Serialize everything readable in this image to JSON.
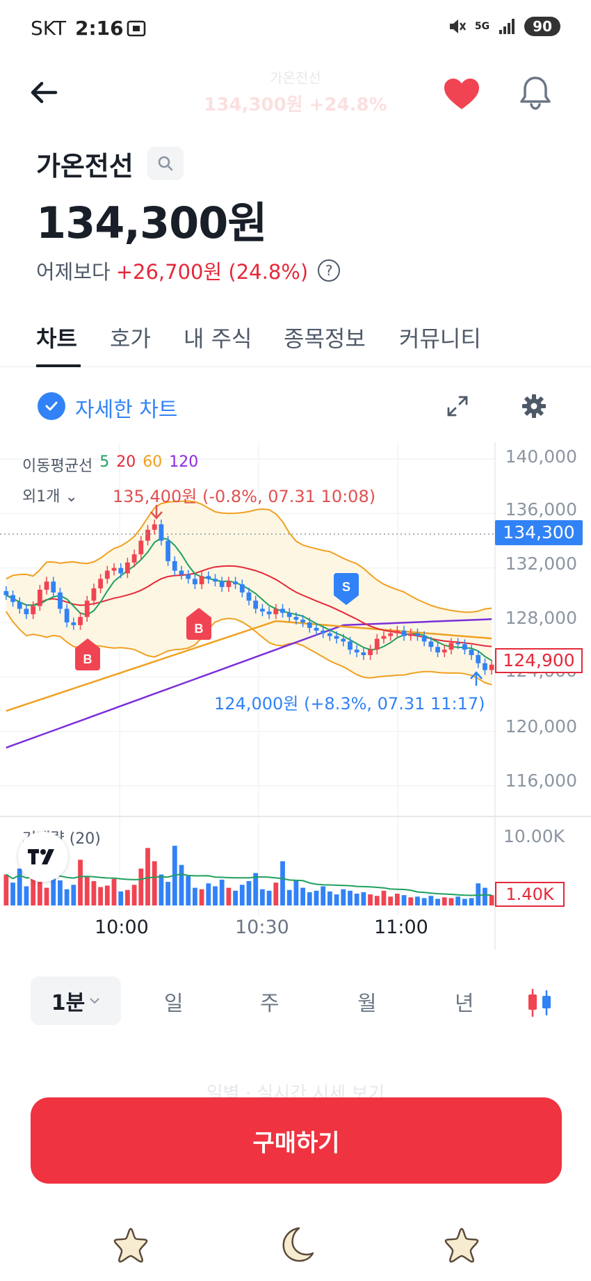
{
  "status_bar": {
    "carrier": "SKT",
    "time": "2:16",
    "network": "5G",
    "battery": "90"
  },
  "header": {
    "ghost_title": "가온전선",
    "ghost_price": "134,300원 +24.8%"
  },
  "stock": {
    "name": "가온전선",
    "price": "134,300원",
    "change_label": "어제보다",
    "change_value": "+26,700원 (24.8%)"
  },
  "tabs": [
    "차트",
    "호가",
    "내 주식",
    "종목정보",
    "커뮤니티"
  ],
  "chart_header": {
    "detail_label": "자세한 차트"
  },
  "chart_data": {
    "type": "candlestick",
    "interval": "1분",
    "legend_prefix": "이동평균선",
    "moving_averages": [
      {
        "period": "5",
        "color": "#1fa05e"
      },
      {
        "period": "20",
        "color": "#e42939"
      },
      {
        "period": "60",
        "color": "#f0a020"
      },
      {
        "period": "120",
        "color": "#8a2be2"
      }
    ],
    "sub_label": "외1개",
    "high_annotation": "135,400원 (-0.8%, 07.31 10:08)",
    "low_annotation": "124,000원 (+8.3%, 07.31 11:17)",
    "y_ticks": [
      "140,000",
      "136,000",
      "132,000",
      "128,000",
      "124,000",
      "120,000",
      "116,000"
    ],
    "ylim": [
      116000,
      140000
    ],
    "current_price_tag": "134,300",
    "last_price_tag": "124,900",
    "x_ticks": [
      "10:00",
      "10:30",
      "11:00"
    ],
    "markers": [
      {
        "label": "B",
        "color": "#f04452"
      },
      {
        "label": "B",
        "color": "#f04452"
      },
      {
        "label": "S",
        "color": "#3182f6"
      }
    ],
    "volume_label": "거래량 (20)",
    "volume_max": "10.00K",
    "volume_last": "1.40K",
    "closes": [
      130000,
      129500,
      129000,
      128600,
      129200,
      130400,
      131000,
      130200,
      129000,
      128000,
      127800,
      128400,
      129600,
      130500,
      131200,
      131800,
      132000,
      131600,
      132400,
      133000,
      134000,
      134800,
      135200,
      134000,
      132500,
      131800,
      131500,
      131200,
      130800,
      131400,
      131200,
      131000,
      130600,
      131000,
      130800,
      130200,
      129600,
      129000,
      128800,
      128600,
      129000,
      128700,
      128400,
      128200,
      128000,
      127600,
      127400,
      127200,
      127000,
      126800,
      126600,
      126000,
      125800,
      125600,
      126000,
      126800,
      127000,
      127200,
      127400,
      127000,
      127200,
      127000,
      126600,
      126200,
      125800,
      126000,
      126500,
      126400,
      126000,
      125600,
      125000,
      124500,
      124900
    ],
    "volumes": [
      4.2,
      3.1,
      5.0,
      2.6,
      4.4,
      3.2,
      2.4,
      7.6,
      3.4,
      2.2,
      2.8,
      6.2,
      4.0,
      3.3,
      2.5,
      2.7,
      3.6,
      1.9,
      2.1,
      2.8,
      5.0,
      7.8,
      6.0,
      4.2,
      3.2,
      8.1,
      5.5,
      4.0,
      2.4,
      2.2,
      3.0,
      2.6,
      3.5,
      2.4,
      2.0,
      2.8,
      3.3,
      4.4,
      2.2,
      2.0,
      3.1,
      6.0,
      2.1,
      3.4,
      2.4,
      1.8,
      2.0,
      2.6,
      1.9,
      1.5,
      2.2,
      2.0,
      1.6,
      1.8,
      1.5,
      1.3,
      2.0,
      1.2,
      1.6,
      1.4,
      1.1,
      1.2,
      1.0,
      1.3,
      0.9,
      1.1,
      1.0,
      1.2,
      0.9,
      1.0,
      3.0,
      2.4,
      1.4
    ]
  },
  "period_selector": {
    "active": "1분",
    "items": [
      "일",
      "주",
      "월",
      "년"
    ]
  },
  "ghost_link": "일별 · 실시간 시세 보기",
  "buy_button": "구매하기"
}
